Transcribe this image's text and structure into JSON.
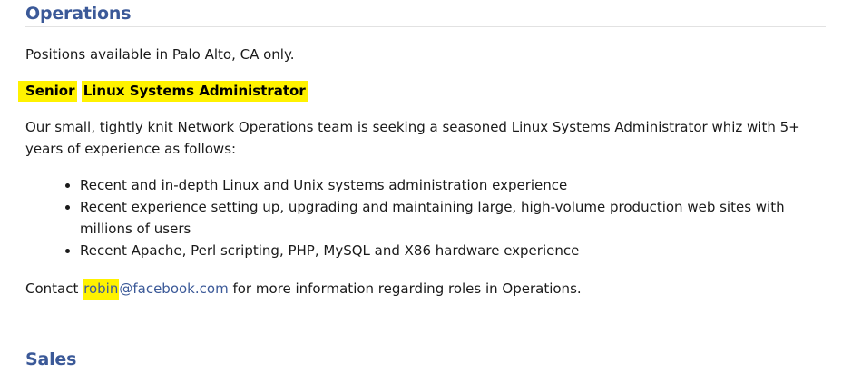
{
  "operations": {
    "heading": "Operations",
    "location_text": "Positions available in Palo Alto, CA only.",
    "job": {
      "title_part1": "Senior",
      "title_part2": "Linux Systems Administrator",
      "intro": "Our small, tightly knit Network Operations team is seeking a seasoned Linux Systems Administrator whiz with 5+ years of experience as follows:",
      "requirements": [
        "Recent and in-depth Linux and Unix systems administration experience",
        "Recent experience setting up, upgrading and maintaining large, high-volume production web sites with millions of users",
        "Recent Apache, Perl scripting, PHP, MySQL and X86 hardware experience"
      ]
    },
    "contact": {
      "prefix": "Contact ",
      "email_user": "robin",
      "email_domain": "@facebook.com",
      "suffix": " for more information regarding roles in Operations."
    }
  },
  "sales": {
    "heading": "Sales"
  },
  "colors": {
    "heading": "#3b5998",
    "highlight": "#fff200",
    "link": "#3b5998"
  }
}
